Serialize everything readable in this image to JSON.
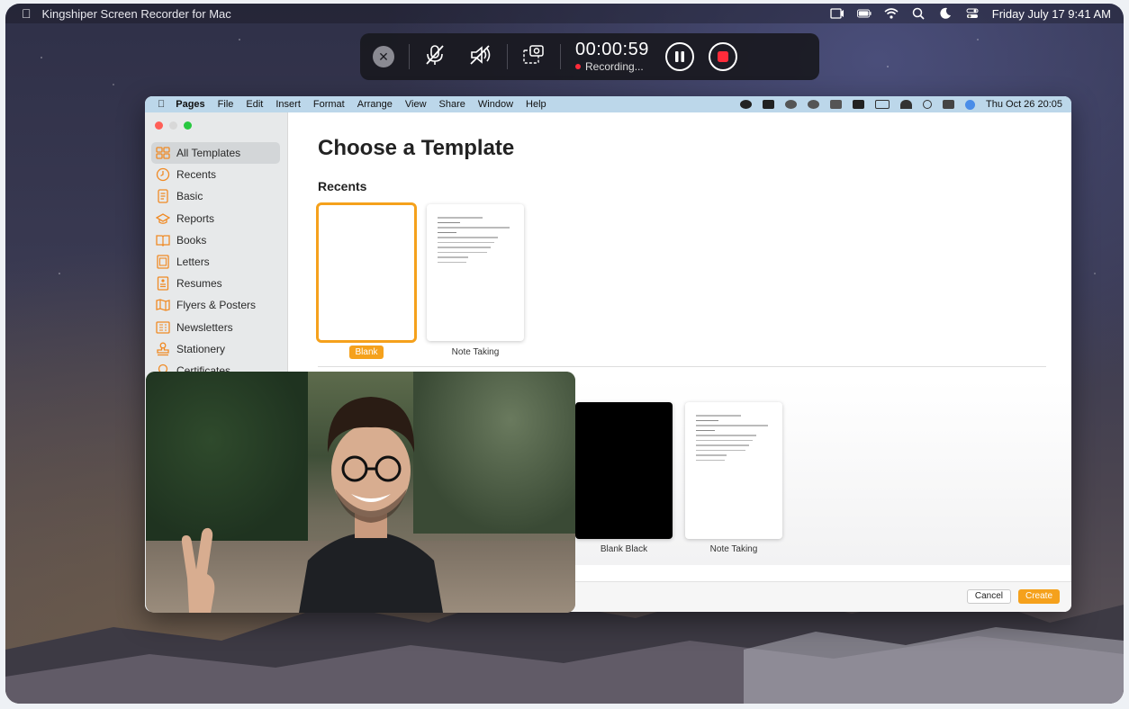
{
  "system_bar": {
    "app_name": "Kingshiper Screen Recorder for Mac",
    "datetime": "Friday July 17  9:41 AM",
    "icons": [
      "screen-record-icon",
      "battery-icon",
      "wifi-icon",
      "search-icon",
      "moon-icon",
      "control-center-icon"
    ]
  },
  "recorder": {
    "timer": "00:00:59",
    "status": "Recording...",
    "icons": [
      "close-icon",
      "mic-muted-icon",
      "speaker-muted-icon",
      "screenshot-icon",
      "pause-icon",
      "stop-icon"
    ],
    "accent": "#ff2b3a"
  },
  "pages": {
    "menu": [
      "Pages",
      "File",
      "Edit",
      "Insert",
      "Format",
      "Arrange",
      "View",
      "Share",
      "Window",
      "Help"
    ],
    "menu_datetime": "Thu Oct 26  20:05",
    "sidebar": [
      {
        "label": "All Templates",
        "icon": "grid-icon"
      },
      {
        "label": "Recents",
        "icon": "clock-icon"
      },
      {
        "label": "Basic",
        "icon": "doc-icon"
      },
      {
        "label": "Reports",
        "icon": "graduation-icon"
      },
      {
        "label": "Books",
        "icon": "book-icon"
      },
      {
        "label": "Letters",
        "icon": "letter-icon"
      },
      {
        "label": "Resumes",
        "icon": "resume-icon"
      },
      {
        "label": "Flyers & Posters",
        "icon": "flyer-icon"
      },
      {
        "label": "Newsletters",
        "icon": "newsletter-icon"
      },
      {
        "label": "Stationery",
        "icon": "stamp-icon"
      },
      {
        "label": "Certificates",
        "icon": "ribbon-icon"
      }
    ],
    "title": "Choose a Template",
    "recents_heading": "Recents",
    "recent_templates": [
      {
        "label": "Blank",
        "selected": true
      },
      {
        "label": "Note Taking",
        "selected": false
      }
    ],
    "basic_templates": [
      {
        "label": "Blank Black"
      },
      {
        "label": "Note Taking"
      }
    ],
    "cancel_label": "Cancel",
    "create_label": "Create",
    "accent": "#f5a11c"
  }
}
